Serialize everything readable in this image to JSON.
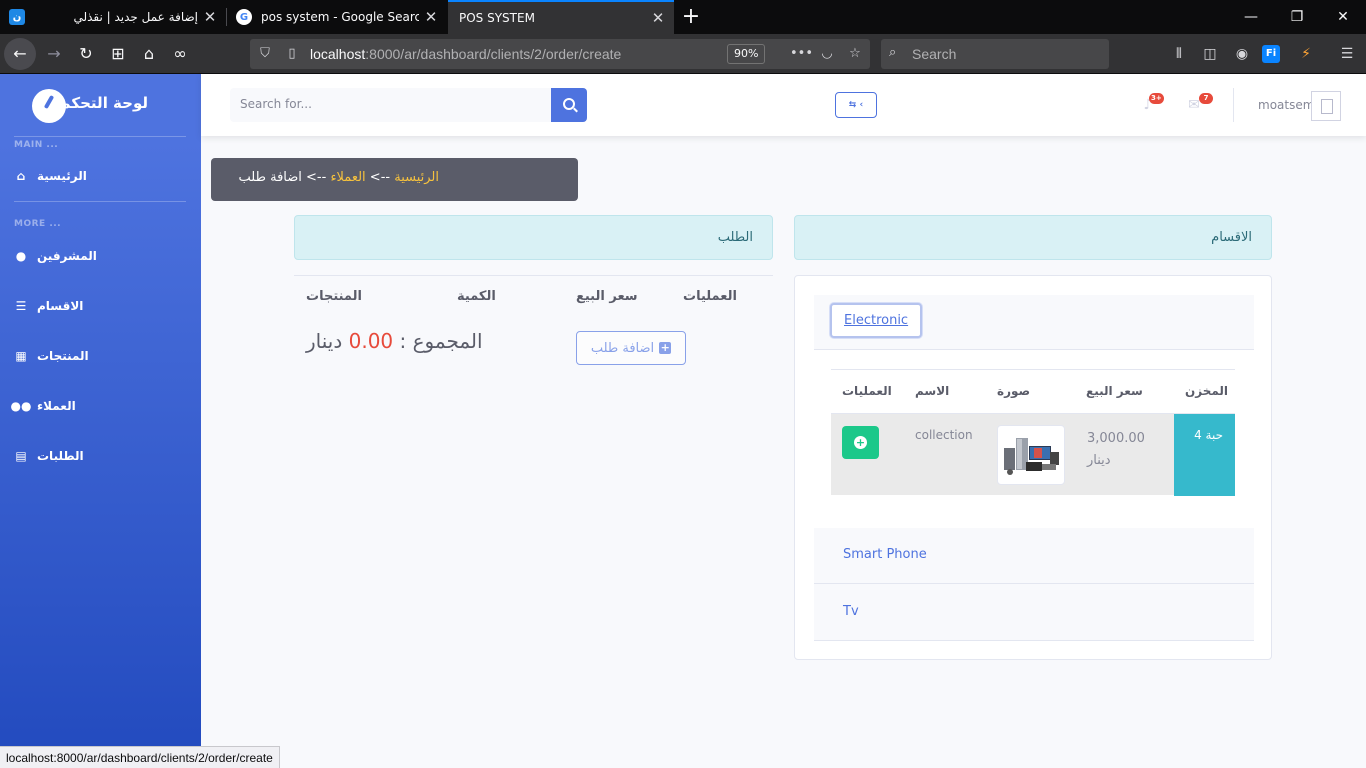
{
  "browser": {
    "tabs": [
      {
        "title": "إضافة عمل جديد | نقذلي",
        "favicon": "ن"
      },
      {
        "title": "pos system - Google Search",
        "favicon": "G"
      },
      {
        "title": "POS SYSTEM",
        "favicon": ""
      }
    ],
    "url": {
      "host": "localhost",
      "rest": ":8000/ar/dashboard/clients/2/order/create"
    },
    "zoom": "90%",
    "search_placeholder": "Search"
  },
  "sidebar": {
    "brand": "لوحة التحكم",
    "heading_main": "MAIN ...",
    "heading_more": "MORE ...",
    "items": [
      {
        "label": "الرئيسية",
        "icon": "home-icon"
      },
      {
        "label": "المشرفين",
        "icon": "user-circle-icon"
      },
      {
        "label": "الاقسام",
        "icon": "list-icon"
      },
      {
        "label": "المنتجات",
        "icon": "boxes-icon"
      },
      {
        "label": "العملاء",
        "icon": "users-icon"
      },
      {
        "label": "الطلبات",
        "icon": "table-list-icon"
      }
    ]
  },
  "topbar": {
    "search_placeholder": "Search for...",
    "lang_label": "⇆ ‹",
    "alerts_badge": "3+",
    "messages_badge": "7",
    "username": "moatsem"
  },
  "breadcrumb": {
    "home": "الرئيسية",
    "sep1": " --> ",
    "clients": "العملاء",
    "sep2": " --> ",
    "current": "اضافة طلب"
  },
  "order": {
    "heading": "الطلب",
    "columns": [
      "المنتجات",
      "الكمية",
      "سعر البيع",
      "العمليات"
    ],
    "total_label": "المجموع : ",
    "total_value": "0.00",
    "currency": "دينار",
    "add_order_button": "اضافة طلب"
  },
  "categories": {
    "heading": "الاقسام",
    "items": [
      "Electronic",
      "Smart Phone",
      "Tv"
    ],
    "product_columns": [
      "المخزن",
      "سعر البيع",
      "صورة",
      "الاسم",
      "العمليات"
    ],
    "products": [
      {
        "stock": "حبة 4",
        "price": "3,000.00",
        "currency": "دينار",
        "name": "collection"
      }
    ]
  },
  "status_url": "localhost:8000/ar/dashboard/clients/2/order/create",
  "colors": {
    "primary": "#4e73df",
    "success": "#1cc88a",
    "info": "#36b9cc",
    "danger": "#e74a3b",
    "warning": "#f6c23e"
  }
}
